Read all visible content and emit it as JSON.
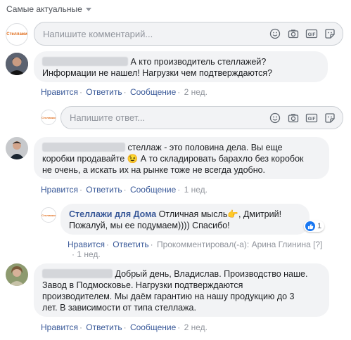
{
  "sort": {
    "label": "Самые актуальные"
  },
  "composer": {
    "placeholder": "Напишите комментарий..."
  },
  "brand_avatar_text": "Стеллажи",
  "comments": [
    {
      "text": "А кто производитель стеллажей? Информации не нашел! Нагрузки чем подтверждаются?",
      "actions": {
        "like": "Нравится",
        "reply": "Ответить",
        "message": "Сообщение",
        "time": "2 нед."
      }
    },
    {
      "text_line1": "стеллаж - это половина дела. Вы еще",
      "text_line2a": "коробки продавайте",
      "emoji": "😉",
      "text_line2b": "А то складировать барахло без коробок",
      "text_line3": "не очень, а искать их на рынке тоже не всегда удобно.",
      "actions": {
        "like": "Нравится",
        "reply": "Ответить",
        "message": "Сообщение",
        "time": "1 нед."
      }
    },
    {
      "text_line1": "Добрый день, Владислав. Производство наше.",
      "text_line2": "Завод в Подмосковье. Нагрузки подтверждаются",
      "text_line3": "производителем. Мы даём гарантию на нашу продукцию до 3",
      "text_line4": "лет. В зависимости от типа стеллажа.",
      "actions": {
        "like": "Нравится",
        "reply": "Ответить",
        "message": "Сообщение",
        "time": "2 нед."
      }
    }
  ],
  "reply_composer": {
    "placeholder": "Напишите ответ..."
  },
  "page_reply": {
    "author": "Стеллажи для Дома",
    "text_line1a": "Отличная мысль",
    "emoji": "👉",
    "text_line1b": ", Дмитрий!",
    "text_line2": "Пожалуй, мы ее подумаем)))) Спасибо!",
    "likes": "1",
    "actions": {
      "like": "Нравится",
      "reply": "Ответить",
      "commented_by": "Прокомментировал(-а): Арина Глинина",
      "help": "[?]",
      "time": "1 нед."
    }
  },
  "colors": {
    "link": "#385898",
    "meta": "#90949c",
    "bubble": "#f2f3f5",
    "like_blue": "#1877f2"
  }
}
